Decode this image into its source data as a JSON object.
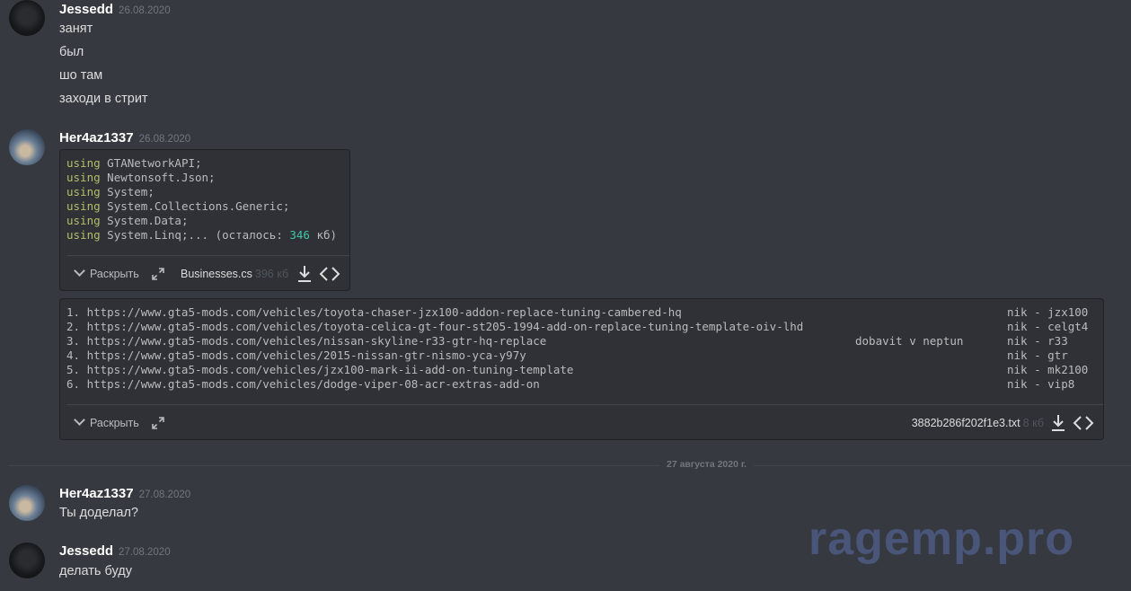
{
  "messages": [
    {
      "user": "Jessedd",
      "time": "26.08.2020",
      "lines": [
        "занят",
        "был",
        "шо там",
        "заходи в стрит"
      ]
    },
    {
      "user": "Her4az1337",
      "time": "26.08.2020"
    },
    {
      "user": "Her4az1337",
      "time": "27.08.2020",
      "lines": [
        "Ты доделал?"
      ]
    },
    {
      "user": "Jessedd",
      "time": "27.08.2020",
      "lines": [
        "делать буду"
      ]
    }
  ],
  "attachment1": {
    "keyword": "using",
    "namespaces": [
      "GTANetworkAPI;",
      "Newtonsoft.Json;",
      "System;",
      "System.Collections.Generic;",
      "System.Data;",
      "System.Linq;... (осталось: "
    ],
    "remaining_value": "346",
    "remaining_unit": " кб)",
    "expand_label": "Раскрыть",
    "filename": "Businesses.cs",
    "filesize": "396 кб"
  },
  "attachment2": {
    "links": [
      "1. https://www.gta5-mods.com/vehicles/toyota-chaser-jzx100-addon-replace-tuning-cambered-hq",
      "2. https://www.gta5-mods.com/vehicles/toyota-celica-gt-four-st205-1994-add-on-replace-tuning-template-oiv-lhd",
      "3. https://www.gta5-mods.com/vehicles/nissan-skyline-r33-gtr-hq-replace",
      "4. https://www.gta5-mods.com/vehicles/2015-nissan-gtr-nismo-yca-y97y",
      "5. https://www.gta5-mods.com/vehicles/jzx100-mark-ii-add-on-tuning-template",
      "6. https://www.gta5-mods.com/vehicles/dodge-viper-08-acr-extras-add-on"
    ],
    "note": "dobavit v neptun",
    "niks": [
      "nik - jzx100",
      "nik - celgt4",
      "nik - r33",
      "nik - gtr",
      "nik - mk2100",
      "nik - vip8"
    ],
    "expand_label": "Раскрыть",
    "filename": "3882b286f202f1e3.txt",
    "filesize": "8 кб"
  },
  "date_divider": "27 августа 2020 г.",
  "watermark": "ragemp.pro",
  "colors": {
    "background": "#36393f",
    "code_bg": "#2f3136",
    "keyword": "#b5bd68",
    "number": "#3ec7a8"
  },
  "icons": [
    "chevron-down-icon",
    "fullscreen-icon",
    "download-icon",
    "code-icon"
  ]
}
